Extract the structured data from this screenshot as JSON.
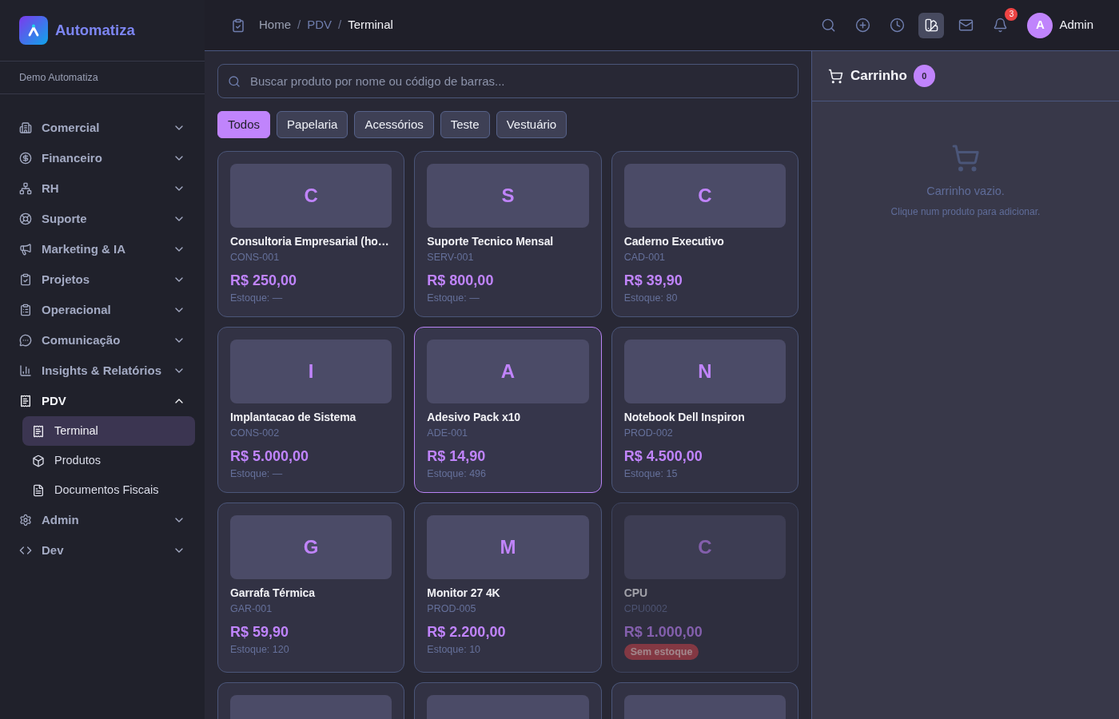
{
  "sidebar": {
    "brand": "Automatiza",
    "workspace": "Demo Automatiza",
    "nav": [
      {
        "label": "Comercial",
        "expanded": false
      },
      {
        "label": "Financeiro",
        "expanded": false
      },
      {
        "label": "RH",
        "expanded": false
      },
      {
        "label": "Suporte",
        "expanded": false
      },
      {
        "label": "Marketing & IA",
        "expanded": false
      },
      {
        "label": "Projetos",
        "expanded": false
      },
      {
        "label": "Operacional",
        "expanded": false
      },
      {
        "label": "Comunicação",
        "expanded": false
      },
      {
        "label": "Insights & Relatórios",
        "expanded": false
      },
      {
        "label": "PDV",
        "expanded": true,
        "children": [
          {
            "label": "Terminal",
            "selected": true
          },
          {
            "label": "Produtos",
            "selected": false
          },
          {
            "label": "Documentos Fiscais",
            "selected": false
          }
        ]
      },
      {
        "label": "Admin",
        "expanded": false
      },
      {
        "label": "Dev",
        "expanded": false
      }
    ]
  },
  "top_bar": {
    "breadcrumb": [
      {
        "label": "Home",
        "kind": "root"
      },
      {
        "label": "/",
        "kind": "separator"
      },
      {
        "label": "PDV",
        "kind": "section"
      },
      {
        "label": "/",
        "kind": "separator"
      },
      {
        "label": "Terminal",
        "kind": "current"
      }
    ],
    "toolbar": [
      {
        "selected": false
      },
      {
        "selected": false
      },
      {
        "selected": false
      },
      {
        "selected": true
      },
      {
        "selected": false
      },
      {
        "selected": false,
        "badge": "3"
      }
    ],
    "user": {
      "initial": "A",
      "name": "Admin"
    }
  },
  "search": {
    "placeholder": "Buscar produto por nome ou código de barras..."
  },
  "categories": [
    {
      "label": "Todos",
      "selected": true
    },
    {
      "label": "Papelaria",
      "selected": false
    },
    {
      "label": "Acessórios",
      "selected": false
    },
    {
      "label": "Teste",
      "selected": false
    },
    {
      "label": "Vestuário",
      "selected": false
    }
  ],
  "products": [
    {
      "kind": "product",
      "initial": "C",
      "name": "Consultoria Empresarial (ho…",
      "code": "CONS-001",
      "price": "R$ 250,00",
      "stock": "Estoque: —",
      "in_stock": true,
      "selected": false
    },
    {
      "kind": "product",
      "initial": "S",
      "name": "Suporte Tecnico Mensal",
      "code": "SERV-001",
      "price": "R$ 800,00",
      "stock": "Estoque: —",
      "in_stock": true,
      "selected": false
    },
    {
      "kind": "product",
      "initial": "C",
      "name": "Caderno Executivo",
      "code": "CAD-001",
      "price": "R$ 39,90",
      "stock": "Estoque: 80",
      "in_stock": true,
      "selected": false
    },
    {
      "kind": "product",
      "initial": "I",
      "name": "Implantacao de Sistema",
      "code": "CONS-002",
      "price": "R$ 5.000,00",
      "stock": "Estoque: —",
      "in_stock": true,
      "selected": false
    },
    {
      "kind": "product",
      "initial": "A",
      "name": "Adesivo Pack x10",
      "code": "ADE-001",
      "price": "R$ 14,90",
      "stock": "Estoque: 496",
      "in_stock": true,
      "selected": true
    },
    {
      "kind": "product",
      "initial": "N",
      "name": "Notebook Dell Inspiron",
      "code": "PROD-002",
      "price": "R$ 4.500,00",
      "stock": "Estoque: 15",
      "in_stock": true,
      "selected": false
    },
    {
      "kind": "product",
      "initial": "G",
      "name": "Garrafa Térmica",
      "code": "GAR-001",
      "price": "R$ 59,90",
      "stock": "Estoque: 120",
      "in_stock": true,
      "selected": false
    },
    {
      "kind": "product",
      "initial": "M",
      "name": "Monitor 27 4K",
      "code": "PROD-005",
      "price": "R$ 2.200,00",
      "stock": "Estoque: 10",
      "in_stock": true,
      "selected": false
    },
    {
      "kind": "product",
      "initial": "C",
      "name": "CPU",
      "code": "CPU0002",
      "price": "R$ 1.000,00",
      "stock": "Sem estoque",
      "in_stock": false,
      "selected": false
    },
    {
      "kind": "partial",
      "selected": false
    },
    {
      "kind": "partial",
      "selected": false
    },
    {
      "kind": "partial",
      "selected": false
    }
  ],
  "cart": {
    "title": "Carrinho",
    "count": "0",
    "empty_title": "Carrinho vazio.",
    "empty_hint": "Clique num produto para adicionar."
  }
}
